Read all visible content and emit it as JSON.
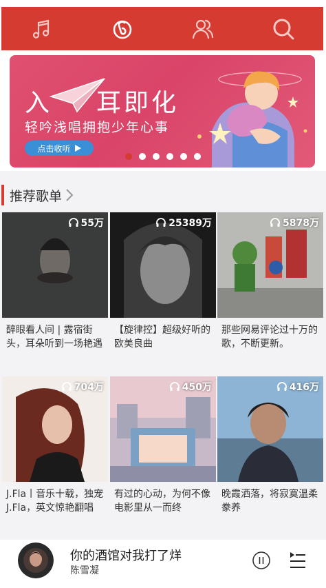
{
  "colors": {
    "brand": "#d63b32",
    "cta": "#3b8fd6",
    "section_bg": "#f3f3f5"
  },
  "header": {
    "tabs": [
      {
        "icon": "music-note-icon"
      },
      {
        "icon": "netease-logo-icon"
      },
      {
        "icon": "friends-icon"
      },
      {
        "icon": "search-icon"
      }
    ]
  },
  "banner": {
    "title_left": "入",
    "title_right": "耳即化",
    "subtitle": "轻吟浅唱拥抱少年心事",
    "cta": "点击收听",
    "dots": 6,
    "active_dot": 0
  },
  "section": {
    "title": "推荐歌单"
  },
  "playlists": [
    {
      "count": "55万",
      "title": "醉眼看人间 | 露宿街头，耳朵听到一场艳遇"
    },
    {
      "count": "25389万",
      "title": "【旋律控】超级好听的欧美良曲"
    },
    {
      "count": "5878万",
      "title": "那些网易评论过十万的歌，不断更新。"
    },
    {
      "count": "704万",
      "title": "J.Fla丨音乐十载，独宠J.Fla，英文惊艳翻唱"
    },
    {
      "count": "450万",
      "title": "有过的心动，为何不像电影里从一而终"
    },
    {
      "count": "416万",
      "title": "晚霞洒落，将寂寞温柔豢养"
    }
  ],
  "player": {
    "song": "你的酒馆对我打了烊",
    "artist": "陈雪凝"
  }
}
